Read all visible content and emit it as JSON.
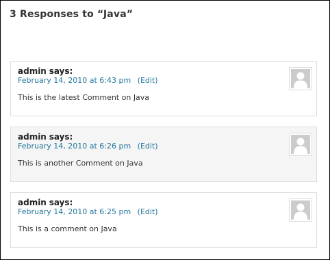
{
  "heading": "3 Responses to “Java”",
  "comments": [
    {
      "author": "admin",
      "says": "says:",
      "date": "February 14, 2010 at 6:43 pm",
      "edit_open": "(",
      "edit_label": "Edit",
      "edit_close": ")",
      "text": "This is the latest Comment on Java",
      "avatar_icon": "default-avatar-icon"
    },
    {
      "author": "admin",
      "says": "says:",
      "date": "February 14, 2010 at 6:26 pm",
      "edit_open": "(",
      "edit_label": "Edit",
      "edit_close": ")",
      "text": "This is another Comment on Java",
      "avatar_icon": "default-avatar-icon"
    },
    {
      "author": "admin",
      "says": "says:",
      "date": "February 14, 2010 at 6:25 pm",
      "edit_open": "(",
      "edit_label": "Edit",
      "edit_close": ")",
      "text": "This is a comment on Java",
      "avatar_icon": "default-avatar-icon"
    }
  ],
  "colors": {
    "link": "#21759b",
    "alt_background": "#f5f5f5",
    "border": "#dddddd",
    "avatar_silhouette": "#cccccc"
  }
}
